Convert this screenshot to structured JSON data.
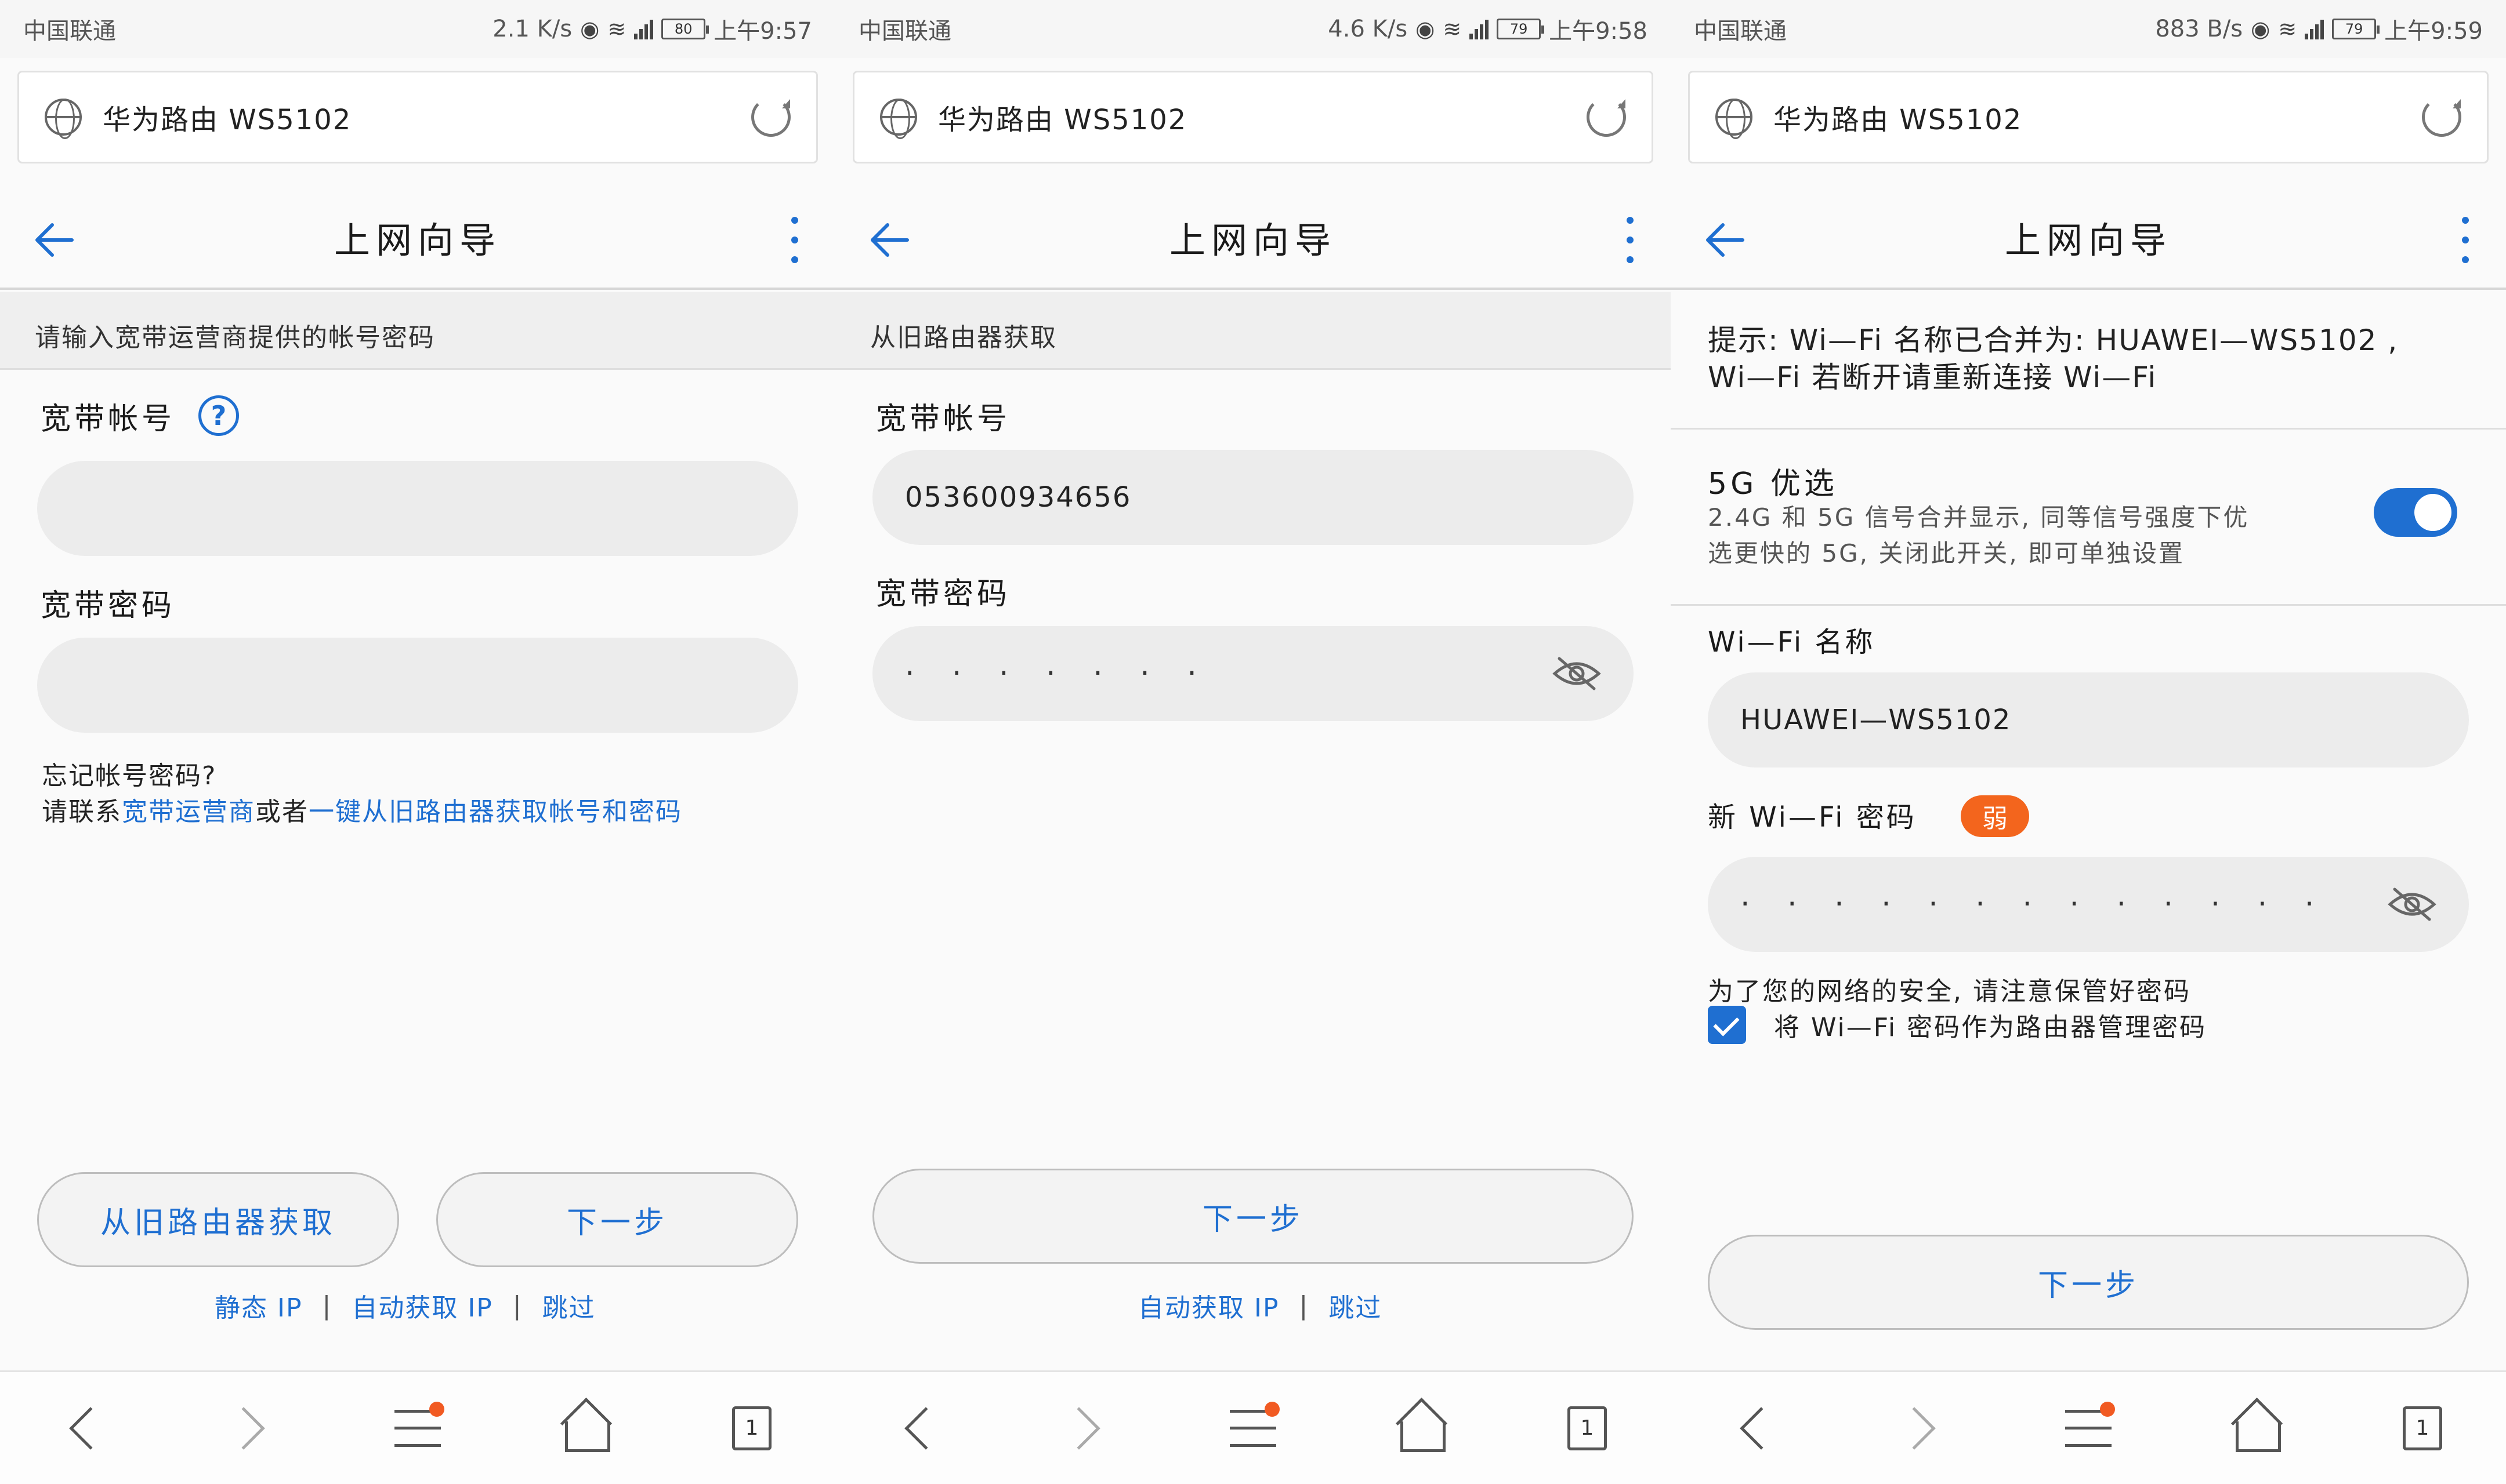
{
  "colors": {
    "accent": "#1f6fd1",
    "weak_badge": "#f3651d",
    "notif_dot": "#f15a22"
  },
  "screens": [
    {
      "status": {
        "carrier": "中国联通",
        "speed": "2.1 K/s",
        "network": "4G",
        "battery": "80",
        "time": "上午9:57"
      },
      "url": "华为路由 WS5102",
      "title": "上网向导",
      "section": "请输入宽带运营商提供的帐号密码",
      "account_label": "宽带帐号",
      "account_value": "",
      "password_label": "宽带密码",
      "password_value": "",
      "forgot": {
        "line1": "忘记帐号密码?",
        "line2_prefix": "请联系",
        "link1": "宽带运营商",
        "middle": "或者",
        "link2": "一键从旧路由器获取帐号和密码"
      },
      "buttons": {
        "fetch": "从旧路由器获取",
        "next": "下一步"
      },
      "links": [
        "静态 IP",
        "自动获取 IP",
        "跳过"
      ],
      "tabs_count": "1"
    },
    {
      "status": {
        "carrier": "中国联通",
        "speed": "4.6 K/s",
        "network": "4G",
        "battery": "79",
        "time": "上午9:58"
      },
      "url": "华为路由 WS5102",
      "title": "上网向导",
      "section": "从旧路由器获取",
      "account_label": "宽带帐号",
      "account_value": "053600934656",
      "password_label": "宽带密码",
      "password_value": "· · · · · · ·",
      "buttons": {
        "next": "下一步"
      },
      "links": [
        "自动获取 IP",
        "跳过"
      ],
      "tabs_count": "1"
    },
    {
      "status": {
        "carrier": "中国联通",
        "speed": "883 B/s",
        "network": "4G",
        "battery": "79",
        "time": "上午9:59"
      },
      "url": "华为路由 WS5102",
      "title": "上网向导",
      "tip_line1": "提示: Wi—Fi 名称已合并为: HUAWEI—WS5102 ,",
      "tip_line2": "Wi—Fi 若断开请重新连接 Wi—Fi",
      "option_title": "5G 优选",
      "option_desc1": "2.4G 和 5G 信号合并显示, 同等信号强度下优",
      "option_desc2": "选更快的 5G, 关闭此开关, 即可单独设置",
      "toggle_on": true,
      "wifi_name_label": "Wi—Fi 名称",
      "wifi_name_value": "HUAWEI—WS5102",
      "wifi_pwd_label": "新 Wi—Fi 密码",
      "strength": "弱",
      "wifi_pwd_value": "· · · · · · · · · · · · ·",
      "security_note": "为了您的网络的安全, 请注意保管好密码",
      "checkbox_label": "将 Wi—Fi 密码作为路由器管理密码",
      "checkbox_checked": true,
      "buttons": {
        "next": "下一步"
      },
      "tabs_count": "1"
    }
  ]
}
